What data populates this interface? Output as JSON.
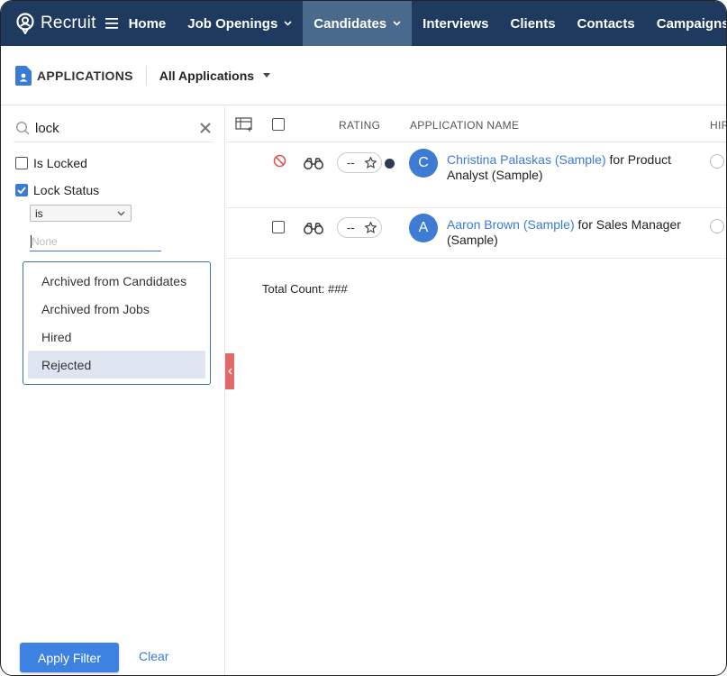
{
  "nav": {
    "logo_text": "Recruit",
    "items": [
      {
        "label": "Home",
        "has_caret": false,
        "active": false
      },
      {
        "label": "Job Openings",
        "has_caret": true,
        "active": false
      },
      {
        "label": "Candidates",
        "has_caret": true,
        "active": true
      },
      {
        "label": "Interviews",
        "has_caret": false,
        "active": false
      },
      {
        "label": "Clients",
        "has_caret": false,
        "active": false
      },
      {
        "label": "Contacts",
        "has_caret": false,
        "active": false
      },
      {
        "label": "Campaigns",
        "has_caret": false,
        "active": false
      }
    ]
  },
  "subheader": {
    "section_title": "APPLICATIONS",
    "view_label": "All Applications"
  },
  "filter": {
    "search_value": "lock",
    "is_locked_label": "Is Locked",
    "is_locked_checked": false,
    "lock_status_label": "Lock Status",
    "lock_status_checked": true,
    "operator_value": "is",
    "value_placeholder": "None",
    "options": [
      "Archived from Candidates",
      "Archived from Jobs",
      "Hired",
      "Rejected"
    ],
    "highlighted_option": "Rejected",
    "apply_label": "Apply Filter",
    "clear_label": "Clear"
  },
  "table": {
    "headers": {
      "rating": "RATING",
      "application_name": "APPLICATION NAME",
      "hiring": "HIR"
    },
    "rows": [
      {
        "avatar_letter": "C",
        "candidate": "Christina Palaskas (Sample)",
        "connector": "for",
        "job": "Product Analyst (Sample)",
        "rating": "--",
        "status_icon": "ban-icon"
      },
      {
        "avatar_letter": "A",
        "candidate": "Aaron Brown (Sample)",
        "connector": "for",
        "job": "Sales Manager (Sample)",
        "rating": "--",
        "status_icon": "checkbox"
      }
    ],
    "total_count": "Total Count: ###"
  },
  "colors": {
    "nav_bg": "#1f3a5f",
    "nav_active": "#4a6a8c",
    "accent": "#3b7bd8",
    "collapse_tab": "#e06a6a"
  }
}
